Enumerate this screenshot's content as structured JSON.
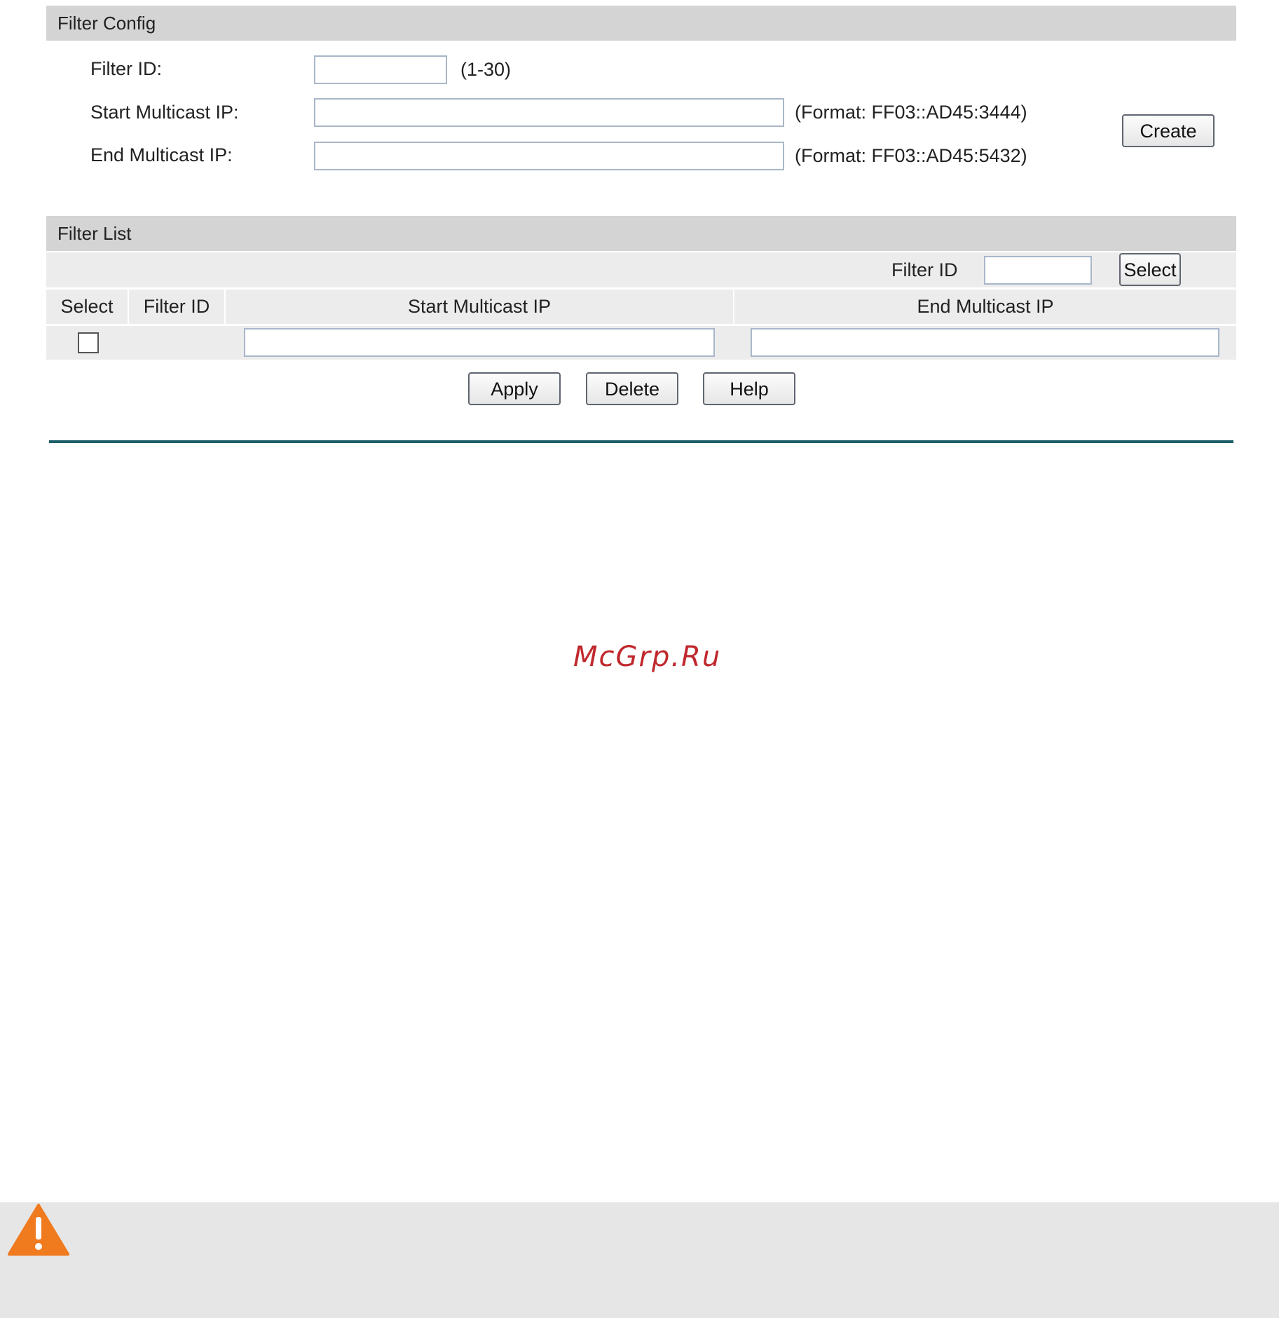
{
  "filter_config": {
    "title": "Filter Config",
    "filter_id_label": "Filter ID:",
    "filter_id_value": "",
    "filter_id_range": "(1-30)",
    "start_ip_label": "Start Multicast IP:",
    "start_ip_value": "",
    "start_ip_format": "(Format: FF03::AD45:3444)",
    "end_ip_label": "End Multicast IP:",
    "end_ip_value": "",
    "end_ip_format": "(Format: FF03::AD45:5432)",
    "create_label": "Create"
  },
  "filter_list": {
    "title": "Filter List",
    "search_label": "Filter ID",
    "search_value": "",
    "select_button_label": "Select",
    "columns": [
      "Select",
      "Filter ID",
      "Start Multicast IP",
      "End Multicast IP"
    ],
    "row": {
      "checked": false,
      "filter_id": "",
      "start_ip": "",
      "end_ip": ""
    }
  },
  "actions": {
    "apply_label": "Apply",
    "delete_label": "Delete",
    "help_label": "Help"
  },
  "watermark": "McGrp.Ru",
  "colors": {
    "section_bar": "#d4d4d4",
    "row_bg": "#ececec",
    "divider_line": "#1d5f6b",
    "warning_orange": "#f07a1e",
    "watermark_red": "#c0282d",
    "note_band": "#e6e6e6"
  },
  "icons": {
    "warning": "warning-triangle-icon"
  }
}
